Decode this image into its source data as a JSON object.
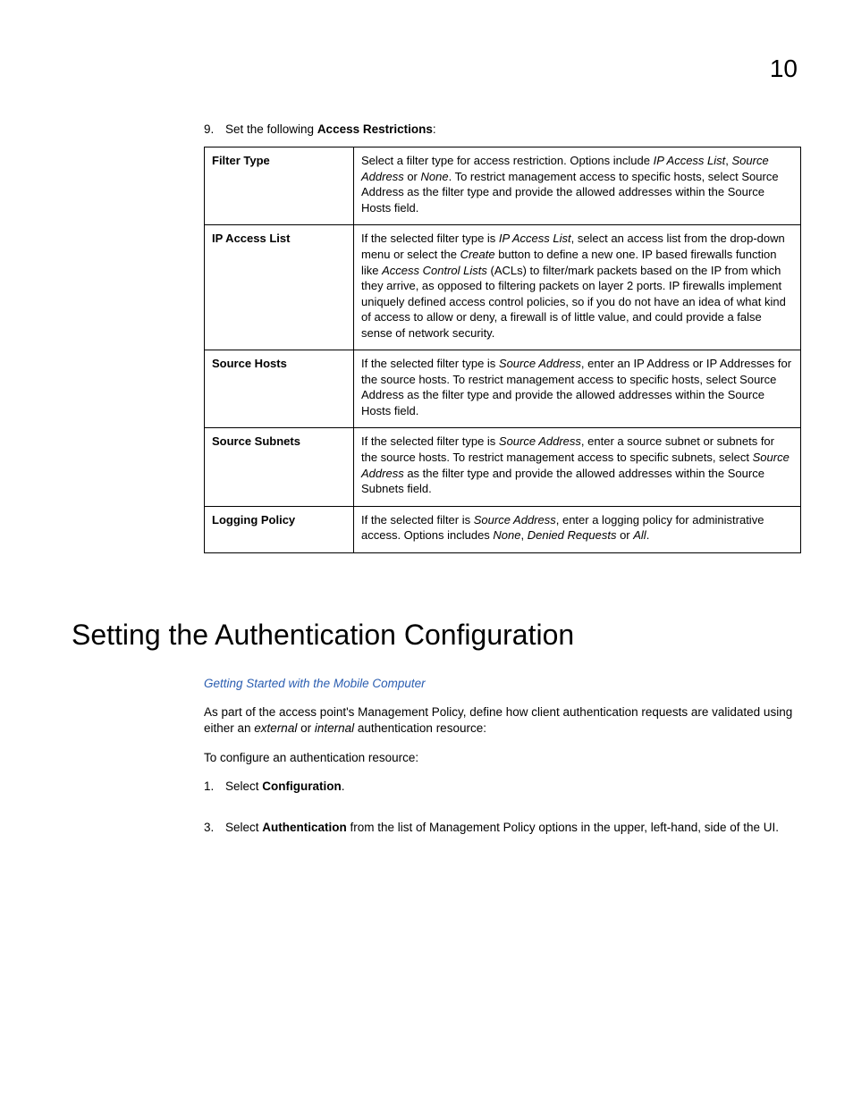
{
  "chapterNumber": "10",
  "step9": {
    "num": "9.",
    "textBefore": "Set the following ",
    "bold": "Access Restrictions",
    "after": ":"
  },
  "table": {
    "rows": [
      {
        "label": "Filter Type",
        "seg": [
          {
            "t": "Select a filter type for access restriction. Options include "
          },
          {
            "t": "IP Access List",
            "i": true
          },
          {
            "t": ", "
          },
          {
            "t": "Source Address",
            "i": true
          },
          {
            "t": " or "
          },
          {
            "t": "None",
            "i": true
          },
          {
            "t": ". To restrict management access to specific hosts, select Source Address as the filter type and provide the allowed addresses within the Source Hosts field."
          }
        ]
      },
      {
        "label": "IP Access List",
        "seg": [
          {
            "t": "If the selected filter type is "
          },
          {
            "t": "IP Access List",
            "i": true
          },
          {
            "t": ", select an access list from the drop-down menu or select the "
          },
          {
            "t": "Create",
            "i": true
          },
          {
            "t": " button to define a new one. IP based firewalls function like "
          },
          {
            "t": "Access Control Lists",
            "i": true
          },
          {
            "t": " (ACLs) to filter/mark packets based on the IP from which they arrive, as opposed to filtering packets on layer 2 ports. IP firewalls implement uniquely defined access control policies, so if you do not have an idea of what kind of access to allow or deny, a firewall is of little value, and could provide a false sense of network security."
          }
        ]
      },
      {
        "label": "Source Hosts",
        "seg": [
          {
            "t": "If the selected filter type is "
          },
          {
            "t": "Source Address",
            "i": true
          },
          {
            "t": ", enter an IP Address or IP Addresses for the source hosts. To restrict management access to specific hosts, select Source Address as the filter type and provide the allowed addresses within the Source Hosts field."
          }
        ]
      },
      {
        "label": "Source Subnets",
        "seg": [
          {
            "t": "If the selected filter type is "
          },
          {
            "t": "Source Address",
            "i": true
          },
          {
            "t": ", enter a source subnet or subnets for the source hosts. To restrict management access to specific subnets, select "
          },
          {
            "t": "Source Address",
            "i": true
          },
          {
            "t": " as the filter type and provide the allowed addresses within the Source Subnets field."
          }
        ]
      },
      {
        "label": "Logging Policy",
        "seg": [
          {
            "t": "If the selected filter is "
          },
          {
            "t": "Source Address",
            "i": true
          },
          {
            "t": ", enter a logging policy for administrative access. Options includes "
          },
          {
            "t": "None",
            "i": true
          },
          {
            "t": ", "
          },
          {
            "t": "Denied Requests",
            "i": true
          },
          {
            "t": " or "
          },
          {
            "t": "All",
            "i": true
          },
          {
            "t": "."
          }
        ]
      }
    ]
  },
  "heading": "Setting the Authentication Configuration",
  "link": "Getting Started with the Mobile Computer",
  "intro": {
    "seg": [
      {
        "t": "As part of the access point's Management Policy, define how client authentication requests are validated using either an "
      },
      {
        "t": "external",
        "i": true
      },
      {
        "t": " or "
      },
      {
        "t": "internal",
        "i": true
      },
      {
        "t": " authentication resource:"
      }
    ]
  },
  "lead": "To configure an authentication resource:",
  "steps": [
    {
      "num": "1.",
      "seg": [
        {
          "t": "Select "
        },
        {
          "t": "Configuration",
          "b": true
        },
        {
          "t": "."
        }
      ]
    },
    {
      "num": "3.",
      "seg": [
        {
          "t": "Select "
        },
        {
          "t": "Authentication",
          "b": true
        },
        {
          "t": " from the list of Management Policy options in the upper, left-hand, side of the UI."
        }
      ]
    }
  ]
}
